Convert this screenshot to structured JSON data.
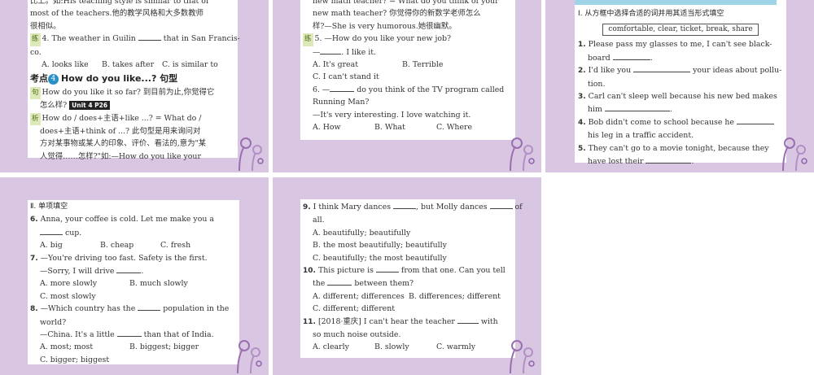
{
  "slide1": {
    "lines": [
      "比上。如:His teaching style is similar to that of",
      "most of the teachers.他的教学风格和大多数教师",
      "很相似。"
    ],
    "q4": {
      "tag": "练",
      "text_a": "4. The weather in Guilin ",
      "text_b": " that in San Francis-",
      "cont": "co.",
      "options": [
        "A. looks like",
        "B. takes after",
        "C. is similar to"
      ]
    },
    "kd": {
      "prefix": "考点",
      "num": "4",
      "title": "How do you like...? 句型"
    },
    "lines2": {
      "l1_tag": "句",
      "l1": "How do you like it so far? 到目前为止,你觉得它",
      "l2": "怎么样?",
      "unit": "Unit 4 P26",
      "l3_tag": "析",
      "l3": "How do / does+主语+like ...? = What do /",
      "l4": "does+主语+think of ...? 此句型是用来询问对",
      "l5": "方对某事物或某人的印象、评价、看法的,意为\"某",
      "l6": "人觉得……怎样?\"如:—How do you like your"
    }
  },
  "slide2": {
    "l1": "new math teacher? = What do you think of your",
    "l2": "new math teacher? 你觉得你的新数学老师怎么",
    "l3": "样?—She is very humorous.她很幽默。",
    "q5": {
      "tag": "练",
      "text": "5. —How do you like your new job?",
      "l2": ". I like it.",
      "opts1": [
        "A. It's great",
        "B. Terrible"
      ],
      "opt3": "C. I can't stand it"
    },
    "q6": {
      "text_a": "6. —",
      "text_b": " do you think of the TV program called",
      "l2": "Running Man?",
      "l3": "—It's very interesting. I love watching it.",
      "options": [
        "A. How",
        "B. What",
        "C. Where"
      ]
    }
  },
  "slide3": {
    "section": "Ⅰ. 从方框中选择合适的词并用其适当形式填空",
    "words": "comfortable, clear, ticket, break, share",
    "items": [
      {
        "n": "1.",
        "a": "Please pass my glasses to me, I can't see black-",
        "b": "board",
        "c": "."
      },
      {
        "n": "2.",
        "a": "I'd like you",
        "a2": "your ideas about pollu-",
        "b": "tion."
      },
      {
        "n": "3.",
        "a": "Carl can't sleep well because his new bed makes",
        "b": "him",
        "c": "."
      },
      {
        "n": "4.",
        "a": "Bob didn't come to school because he",
        "b": "his leg in a traffic accident."
      },
      {
        "n": "5.",
        "a": "They can't go to a movie tonight, because they",
        "b": "have lost their",
        "c": "."
      }
    ]
  },
  "slide4": {
    "section": "Ⅱ. 单项填空",
    "q6": {
      "n": "6.",
      "a": "Anna, your coffee is cold. Let me make you a",
      "b": "cup.",
      "options": [
        "A. big",
        "B. cheap",
        "C. fresh"
      ]
    },
    "q7": {
      "n": "7.",
      "a": "—You're driving too fast. Safety is the first.",
      "b": "—Sorry, I will drive",
      "opts1": [
        "A. more slowly",
        "B. much slowly"
      ],
      "opt3": "C. most slowly"
    },
    "q8": {
      "n": "8.",
      "a": "—Which country has the",
      "a2": "population in the",
      "b": "world?",
      "c": "—China. It's a little",
      "c2": "than that of India.",
      "opts1": [
        "A. most; most",
        "B. biggest; bigger"
      ],
      "opt3": "C. bigger; biggest"
    }
  },
  "slide5": {
    "q9": {
      "n": "9.",
      "a": "I think Mary dances",
      "a2": ", but Molly dances",
      "a3": "of",
      "b": "all.",
      "options": [
        "A. beautifully; beautifully",
        "B. the most beautifully; beautifully",
        "C. beautifully; the most beautifully"
      ]
    },
    "q10": {
      "n": "10.",
      "a": "This picture is",
      "a2": "from that one. Can you tell",
      "b": "the",
      "b2": "between them?",
      "opts1": [
        "A. different; differences",
        "B. differences; different"
      ],
      "opt3": "C. different; different"
    },
    "q11": {
      "n": "11.",
      "a": "[2018·重庆] I can't hear the teacher",
      "a2": "with",
      "b": "so much noise outside.",
      "options": [
        "A. clearly",
        "B. slowly",
        "C. warmly"
      ]
    }
  },
  "colors": {
    "slide_bg": "#d9c6e2",
    "label_bg": "#dde9b8",
    "badge": "#2b8fc7"
  }
}
